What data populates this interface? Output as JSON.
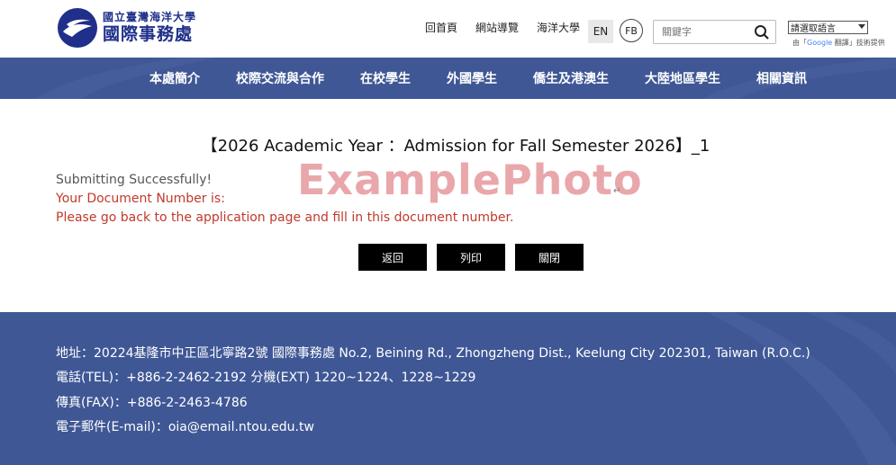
{
  "header": {
    "logo_small": "國立臺灣海洋大學",
    "logo_big": "國際事務處",
    "top_links": [
      "回首頁",
      "網站導覽",
      "海洋大學"
    ],
    "lang_button": "EN",
    "fb_button": "FB",
    "search_placeholder": "關鍵字",
    "lang_select": "請選取語言",
    "google_note_prefix": "由「",
    "google_note_g": "Google",
    "google_note_suffix": " 翻譯」技術提供"
  },
  "nav": {
    "items": [
      "本處簡介",
      "校際交流與合作",
      "在校學生",
      "外國學生",
      "僑生及港澳生",
      "大陸地區學生",
      "相關資訊"
    ]
  },
  "main": {
    "title": "【2026 Academic Year ：Admission for Fall Semester 2026】_1",
    "success_msg": "Submitting Successfully!",
    "doc_number_label": "Your Document Number is:",
    "go_back_msg": "Please go back to the application page and fill in this document number.",
    "watermark": "ExamplePhoto",
    "para_mark": "↵",
    "buttons": [
      "返回",
      "列印",
      "關閉"
    ]
  },
  "footer": {
    "address": "地址：20224基隆市中正區北寧路2號 國際事務處 No.2, Beining Rd., Zhongzheng Dist., Keelung City 202301, Taiwan (R.O.C.)",
    "phone": "電話(TEL)：+886-2-2462-2192 分機(EXT) 1220~1224、1228~1229",
    "fax": "傳真(FAX)：+886-2-2463-4786",
    "email": "電子郵件(E-mail)：oia@email.ntou.edu.tw"
  },
  "colors": {
    "nav_bg": "#3f5795",
    "brand": "#1f2f8a",
    "alert": "#c0392b",
    "watermark": "#e9a7ab"
  },
  "icons": [
    "logo-icon",
    "search-icon",
    "dropdown-arrow-icon"
  ]
}
